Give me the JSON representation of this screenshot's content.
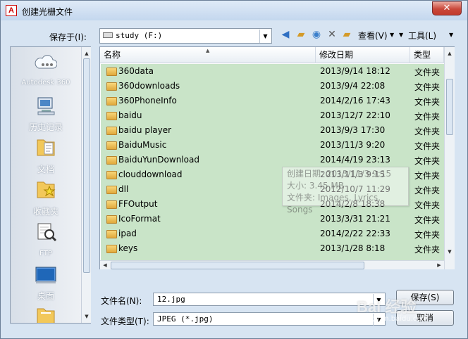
{
  "window": {
    "title": "创建光栅文件",
    "close": "✕"
  },
  "toolbar": {
    "save_in_label": "保存于(I):",
    "location": "study (F:)",
    "view_label": "查看(V)",
    "tools_label": "工具(L)",
    "icons": [
      "back-icon",
      "up-folder-icon",
      "search-web-icon",
      "delete-icon",
      "new-folder-icon"
    ]
  },
  "sidebar": {
    "items": [
      {
        "label": "Autodesk 360",
        "icon": "cloud-icon"
      },
      {
        "label": "历史记录",
        "icon": "history-icon"
      },
      {
        "label": "文档",
        "icon": "documents-icon"
      },
      {
        "label": "收藏夹",
        "icon": "favorites-icon"
      },
      {
        "label": "FTP",
        "icon": "ftp-icon"
      },
      {
        "label": "桌面",
        "icon": "desktop-icon"
      }
    ]
  },
  "file_list": {
    "columns": [
      "名称",
      "修改日期",
      "类型"
    ],
    "rows": [
      {
        "name": "360data",
        "date": "2013/9/14 18:12",
        "type": "文件夹"
      },
      {
        "name": "360downloads",
        "date": "2013/9/4 22:08",
        "type": "文件夹"
      },
      {
        "name": "360PhoneInfo",
        "date": "2014/2/16 17:43",
        "type": "文件夹"
      },
      {
        "name": "baidu",
        "date": "2013/12/7 22:10",
        "type": "文件夹"
      },
      {
        "name": "baidu player",
        "date": "2013/9/3 17:30",
        "type": "文件夹"
      },
      {
        "name": "BaiduMusic",
        "date": "2013/11/3 9:20",
        "type": "文件夹"
      },
      {
        "name": "BaiduYunDownload",
        "date": "2014/4/19 23:13",
        "type": "文件夹"
      },
      {
        "name": "clouddownload",
        "date": "2013/11/3 9:15",
        "type": "文件夹"
      },
      {
        "name": "dll",
        "date": "2012/10/7 11:29",
        "type": "文件夹"
      },
      {
        "name": "FFOutput",
        "date": "2014/2/8 18:38",
        "type": "文件夹"
      },
      {
        "name": "IcoFormat",
        "date": "2013/3/31 21:21",
        "type": "文件夹"
      },
      {
        "name": "ipad",
        "date": "2014/2/22 22:33",
        "type": "文件夹"
      },
      {
        "name": "keys",
        "date": "2013/1/28 8:18",
        "type": "文件夹"
      }
    ]
  },
  "tooltip": {
    "created": "创建日期: 2013/11/3 9:15",
    "size": "大小: 3.45 MB",
    "files": "文件夹: Images, Lyrics, Songs"
  },
  "bottom": {
    "filename_label": "文件名(N):",
    "filename_value": "12.jpg",
    "filetype_label": "文件类型(T):",
    "filetype_value": "JPEG (*.jpg)",
    "save_button": "保存(S)",
    "cancel_button": "取消"
  },
  "watermark": {
    "main": "Bai 经验",
    "sub": "jingyan.baidu.com"
  }
}
